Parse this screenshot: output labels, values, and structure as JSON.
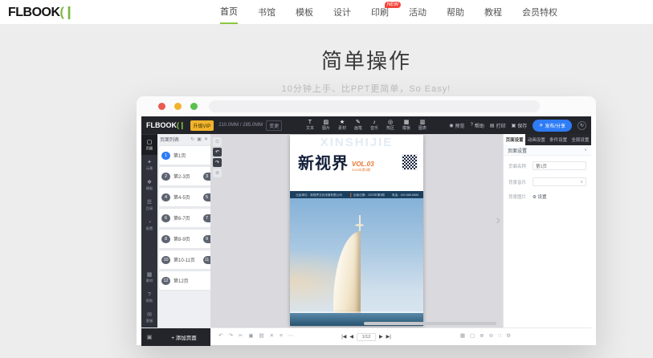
{
  "colors": {
    "accent_green": "#8cc63e",
    "accent_blue": "#2e7cf6",
    "badge_red": "#f3473c",
    "vip_yellow": "#f0b32c",
    "cover_navy": "#1c3f5e",
    "cover_orange": "#e8762e"
  },
  "site": {
    "logo_text": "FLBOOK",
    "logo_mark": "(❙",
    "nav": [
      {
        "label": "首页",
        "active": true
      },
      {
        "label": "书馆"
      },
      {
        "label": "模板"
      },
      {
        "label": "设计"
      },
      {
        "label": "印刷",
        "badge": "NEW"
      },
      {
        "label": "活动"
      },
      {
        "label": "帮助"
      },
      {
        "label": "教程"
      },
      {
        "label": "会员特权"
      }
    ]
  },
  "hero": {
    "title": "简单操作",
    "subtitle": "10分钟上手、比PPT更简单，So Easy!"
  },
  "editor": {
    "topbar": {
      "logo_text": "FLBOOK",
      "logo_mark": "(❙",
      "vip_badge": "升级VIP",
      "doc_size": "210.0MM / 285.0MM",
      "size_chip": "变更",
      "tools": [
        {
          "name": "text",
          "glyph": "T",
          "label": "文本"
        },
        {
          "name": "image",
          "glyph": "▨",
          "label": "图片"
        },
        {
          "name": "material",
          "glyph": "★",
          "label": "素材"
        },
        {
          "name": "brush",
          "glyph": "✎",
          "label": "画笔"
        },
        {
          "name": "music",
          "glyph": "♪",
          "label": "音乐"
        },
        {
          "name": "hotspot",
          "glyph": "◎",
          "label": "热区"
        },
        {
          "name": "template",
          "glyph": "▦",
          "label": "模板"
        },
        {
          "name": "chart",
          "glyph": "▥",
          "label": "图表"
        }
      ],
      "actions": [
        {
          "name": "preview",
          "glyph": "◉",
          "label": "预览"
        },
        {
          "name": "help",
          "glyph": "?",
          "label": "帮助"
        },
        {
          "name": "print",
          "glyph": "▤",
          "label": "打印"
        },
        {
          "name": "save",
          "glyph": "▣",
          "label": "保存"
        }
      ],
      "publish": {
        "glyph": "✈",
        "label": "发布/分享"
      },
      "avatar_glyph": "↻"
    },
    "rail": {
      "top": [
        {
          "name": "pages",
          "glyph": "▢",
          "label": "页面",
          "active": true
        },
        {
          "name": "elements",
          "glyph": "✦",
          "label": "元素"
        },
        {
          "name": "templates",
          "glyph": "❖",
          "label": "模板"
        },
        {
          "name": "catalog",
          "glyph": "☰",
          "label": "目录"
        },
        {
          "name": "config",
          "glyph": "◔",
          "label": "配置"
        }
      ],
      "bottom": [
        {
          "name": "assets",
          "glyph": "▦",
          "label": "素材"
        },
        {
          "name": "support",
          "glyph": "?",
          "label": "帮助"
        },
        {
          "name": "service",
          "glyph": "✉",
          "label": "客服"
        }
      ]
    },
    "pages_panel": {
      "title": "页面列表",
      "header_icons": [
        {
          "name": "refresh-icon",
          "glyph": "↻"
        },
        {
          "name": "copy-icon",
          "glyph": "▣"
        },
        {
          "name": "delete-icon",
          "glyph": "✕"
        }
      ],
      "rows": [
        {
          "left": "1",
          "label": "第1页",
          "active": true
        },
        {
          "left": "2",
          "label": "第2-3页",
          "right": "3"
        },
        {
          "left": "4",
          "label": "第4-5页",
          "right": "5"
        },
        {
          "left": "6",
          "label": "第6-7页",
          "right": "7"
        },
        {
          "left": "8",
          "label": "第8-9页",
          "right": "9"
        },
        {
          "left": "10",
          "label": "第10-11页",
          "right": "11"
        },
        {
          "left": "12",
          "label": "第12页"
        }
      ]
    },
    "canvas": {
      "mini_tools": [
        {
          "name": "settings",
          "glyph": "⊙",
          "dark": false
        },
        {
          "name": "undo",
          "glyph": "↶",
          "dark": true
        },
        {
          "name": "redo",
          "glyph": "↷",
          "dark": true
        },
        {
          "name": "lock",
          "glyph": "⊕",
          "dark": false
        }
      ],
      "cover": {
        "watermark": "XINSHIJIE",
        "title": "新视界",
        "vol": "VOL.03",
        "issue": "2020年第3期",
        "info_bar": [
          "出品单位：新视界文化传媒有限公司",
          "出版日期：2020年第3期",
          "电话：400-888-8888"
        ]
      },
      "next_arrow": "›"
    },
    "inspector": {
      "tabs": [
        {
          "label": "页面设置",
          "active": true
        },
        {
          "label": "动画设置"
        },
        {
          "label": "条件设置"
        },
        {
          "label": "全局设置"
        }
      ],
      "section_title": "页面设置",
      "section_chevron": "∨",
      "fields": [
        {
          "label": "页面名称",
          "type": "input",
          "value": "第1页"
        },
        {
          "label": "背景音乐",
          "type": "select",
          "value": ""
        },
        {
          "label": "背景图片",
          "type": "button",
          "value": "⚙ 设置"
        }
      ]
    },
    "bottombar": {
      "corner_glyph": "▣",
      "add_label": "+ 添加页面",
      "left_icons": [
        {
          "name": "undo-icon",
          "glyph": "↶"
        },
        {
          "name": "redo-icon",
          "glyph": "↷"
        },
        {
          "name": "cut-icon",
          "glyph": "✂"
        },
        {
          "name": "copy-icon",
          "glyph": "▣"
        },
        {
          "name": "paste-icon",
          "glyph": "▤"
        },
        {
          "name": "delete-icon",
          "glyph": "✕"
        },
        {
          "name": "align-icon",
          "glyph": "≡"
        },
        {
          "name": "more-icon",
          "glyph": "⋯"
        }
      ],
      "pager": {
        "first": "|◀",
        "prev": "◀",
        "value": "1/12",
        "next": "▶",
        "last": "▶|"
      },
      "right_icons": [
        {
          "name": "thumbnails-icon",
          "glyph": "▦"
        },
        {
          "name": "fit-icon",
          "glyph": "▢"
        },
        {
          "name": "zoom-in-icon",
          "glyph": "⊕"
        },
        {
          "name": "zoom-out-icon",
          "glyph": "⊖"
        },
        {
          "name": "fullscreen-icon",
          "glyph": "∷"
        },
        {
          "name": "settings-icon",
          "glyph": "⚙"
        }
      ]
    }
  }
}
